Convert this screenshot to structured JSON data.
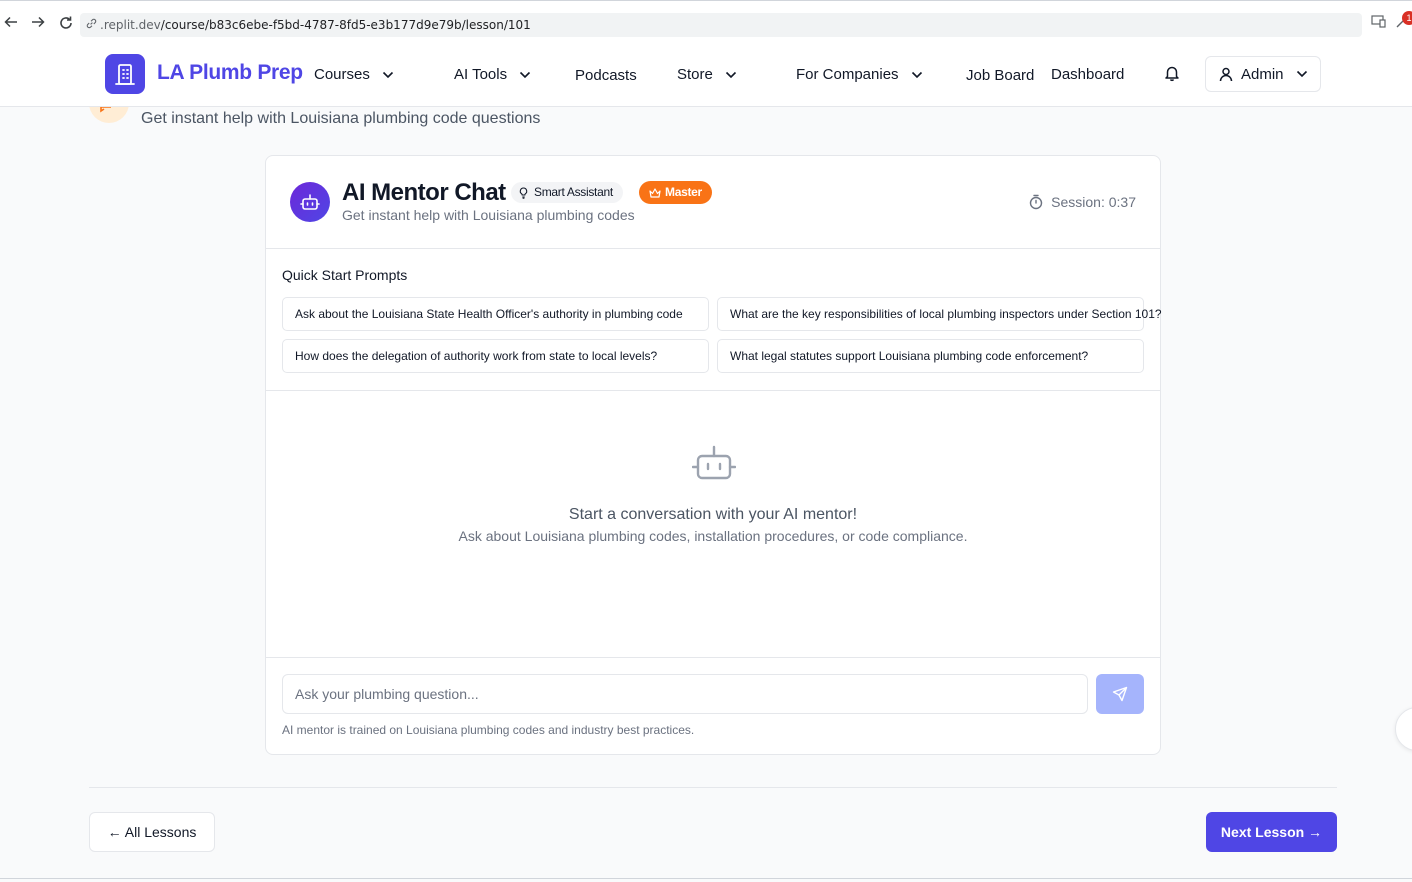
{
  "browser": {
    "url_host": ".replit.dev",
    "url_path": "/course/b83c6ebe-f5bd-4787-8fd5-e3b177d9e79b/lesson/101",
    "ext_badge": "1"
  },
  "header": {
    "brand": "LA Plumb Prep",
    "nav": [
      {
        "label": "Courses"
      },
      {
        "label": "AI Tools"
      },
      {
        "label": "Podcasts"
      },
      {
        "label": "Store"
      },
      {
        "label": "For Companies"
      },
      {
        "label": "Job Board"
      },
      {
        "label": "Dashboard"
      }
    ],
    "user_label": "Admin"
  },
  "page": {
    "subtitle": "Get instant help with Louisiana plumbing code questions"
  },
  "chat": {
    "title": "AI Mentor Chat",
    "badge_smart": "Smart Assistant",
    "badge_master": "Master",
    "subtitle": "Get instant help with Louisiana plumbing codes",
    "session": "Session: 0:37",
    "prompts_title": "Quick Start Prompts",
    "prompts": [
      "Ask about the Louisiana State Health Officer's authority in plumbing code",
      "What are the key responsibilities of local plumbing inspectors under Section 101?",
      "How does the delegation of authority work from state to local levels?",
      "What legal statutes support Louisiana plumbing code enforcement?"
    ],
    "empty_title": "Start a conversation with your AI mentor!",
    "empty_sub": "Ask about Louisiana plumbing codes, installation procedures, or code compliance.",
    "input_placeholder": "Ask your plumbing question...",
    "input_value": "",
    "footnote": "AI mentor is trained on Louisiana plumbing codes and industry best practices."
  },
  "footer_nav": {
    "all_lessons": "← All Lessons",
    "next_lesson": "Next Lesson →"
  },
  "colors": {
    "brand": "#4f46e5",
    "master_badge": "#f97316",
    "send_button_disabled": "#a5b4fc",
    "page_bg": "#f9fafb"
  },
  "icons": {
    "back": "arrow-left-icon",
    "forward": "arrow-right-icon",
    "reload": "reload-icon",
    "logo": "building-icon",
    "bell": "bell-icon",
    "user": "user-icon",
    "chevron": "chevron-down-icon",
    "avatar": "bot-icon",
    "smart": "lightbulb-icon",
    "master": "crown-icon",
    "timer": "timer-icon",
    "send": "send-icon"
  }
}
